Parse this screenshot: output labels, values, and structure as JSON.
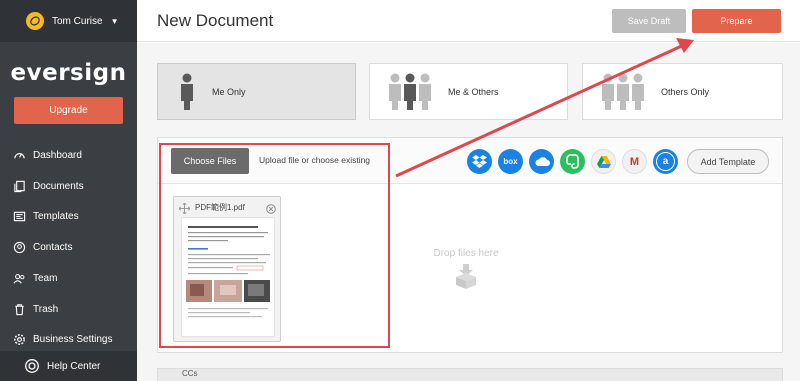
{
  "user": {
    "name": "Tom Curise",
    "avatar_icon": "lemon-avatar-icon"
  },
  "logo": "eversign",
  "sidebar": {
    "upgrade_label": "Upgrade",
    "items": [
      {
        "label": "Dashboard",
        "icon": "dashboard-icon"
      },
      {
        "label": "Documents",
        "icon": "documents-icon"
      },
      {
        "label": "Templates",
        "icon": "templates-icon"
      },
      {
        "label": "Contacts",
        "icon": "contacts-icon"
      },
      {
        "label": "Team",
        "icon": "team-icon"
      },
      {
        "label": "Trash",
        "icon": "trash-icon"
      },
      {
        "label": "Business Settings",
        "icon": "settings-icon"
      }
    ],
    "help_label": "Help Center"
  },
  "header": {
    "title": "New Document",
    "save_draft_label": "Save Draft",
    "prepare_label": "Prepare"
  },
  "signers": {
    "options": [
      {
        "label": "Me Only",
        "selected": true
      },
      {
        "label": "Me & Others",
        "selected": false
      },
      {
        "label": "Others Only",
        "selected": false
      }
    ]
  },
  "upload": {
    "choose_label": "Choose Files",
    "hint": "Upload file or choose existing",
    "sources": [
      {
        "name": "dropbox-icon",
        "glyph": "",
        "color": "#1a82e2"
      },
      {
        "name": "box-icon",
        "glyph": "box",
        "color": "#1a82e2"
      },
      {
        "name": "onedrive-icon",
        "glyph": "",
        "color": "#1a82e2"
      },
      {
        "name": "evernote-icon",
        "glyph": "",
        "color": "#2dbe60"
      },
      {
        "name": "google-drive-icon",
        "glyph": "",
        "color": "#f1f1f1"
      },
      {
        "name": "gmail-icon",
        "glyph": "M",
        "color": "#f1f1f1"
      },
      {
        "name": "amazon-icon",
        "glyph": "a",
        "color": "#1a82e2"
      }
    ],
    "add_template_label": "Add Template",
    "document": {
      "name": "PDF範例1.pdf"
    },
    "drop_text": "Drop files here"
  },
  "ccs_label": "CCs",
  "colors": {
    "accent": "#e2644d",
    "sidebar": "#3b3e43",
    "highlight": "#e0474c"
  }
}
